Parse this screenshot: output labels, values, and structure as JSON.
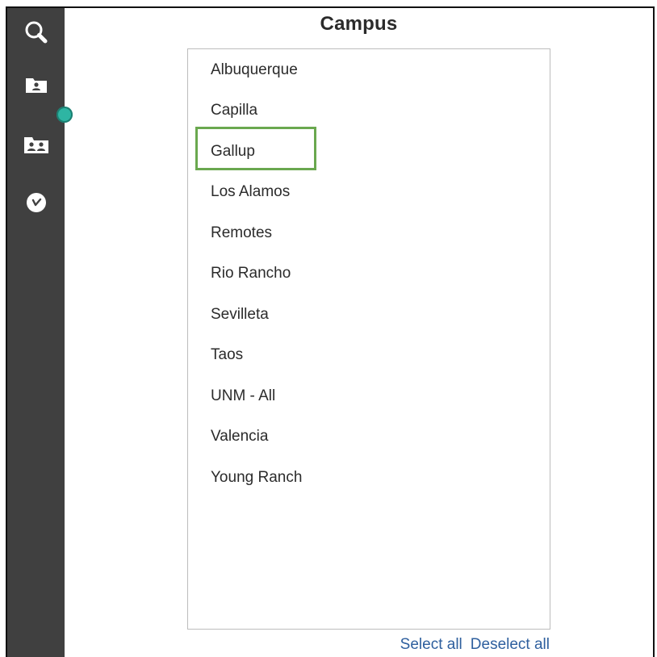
{
  "panel": {
    "title": "Campus"
  },
  "sidebar": {
    "items": [
      {
        "icon": "search-icon"
      },
      {
        "icon": "folder-user-icon"
      },
      {
        "icon": "folder-users-icon"
      },
      {
        "icon": "clock-check-icon"
      }
    ],
    "accent_color": "#2eb5a3"
  },
  "campus_list": {
    "items": [
      {
        "label": "Albuquerque"
      },
      {
        "label": "Capilla"
      },
      {
        "label": "Gallup",
        "highlighted": true
      },
      {
        "label": "Los Alamos"
      },
      {
        "label": "Remotes"
      },
      {
        "label": "Rio Rancho"
      },
      {
        "label": "Sevilleta"
      },
      {
        "label": "Taos"
      },
      {
        "label": "UNM - All"
      },
      {
        "label": "Valencia"
      },
      {
        "label": "Young Ranch"
      }
    ],
    "highlight_color": "#6aa84f"
  },
  "actions": {
    "select_all": "Select all",
    "deselect_all": "Deselect all",
    "link_color": "#2e5f9e"
  }
}
